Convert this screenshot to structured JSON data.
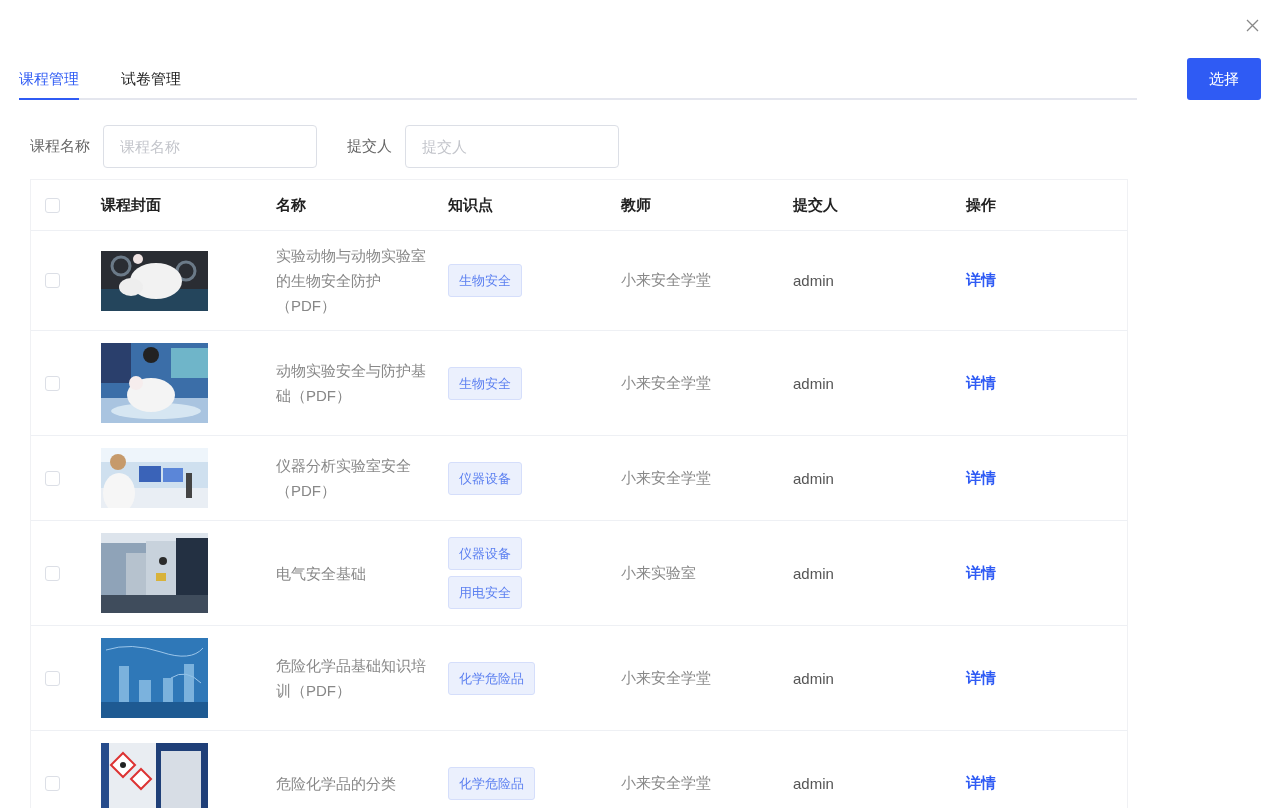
{
  "tabs": [
    {
      "label": "课程管理",
      "selected": true
    },
    {
      "label": "试卷管理",
      "selected": false
    }
  ],
  "select_button": "选择",
  "filters": [
    {
      "label": "课程名称",
      "placeholder": "课程名称"
    },
    {
      "label": "提交人",
      "placeholder": "提交人"
    }
  ],
  "table": {
    "select_all_checked": false,
    "columns": [
      "课程封面",
      "名称",
      "知识点",
      "教师",
      "提交人",
      "操作"
    ],
    "rows": [
      {
        "checked": false,
        "name": "实验动物与动物实验室的生物安全防护（PDF）",
        "tags": [
          "生物安全"
        ],
        "teacher": "小来安全学堂",
        "submitter": "admin",
        "action": "详情"
      },
      {
        "checked": false,
        "name": "动物实验安全与防护基础（PDF）",
        "tags": [
          "生物安全"
        ],
        "teacher": "小来安全学堂",
        "submitter": "admin",
        "action": "详情"
      },
      {
        "checked": false,
        "name": "仪器分析实验室安全（PDF）",
        "tags": [
          "仪器设备"
        ],
        "teacher": "小来安全学堂",
        "submitter": "admin",
        "action": "详情"
      },
      {
        "checked": false,
        "name": "电气安全基础",
        "tags": [
          "仪器设备",
          "用电安全"
        ],
        "teacher": "小来实验室",
        "submitter": "admin",
        "action": "详情"
      },
      {
        "checked": false,
        "name": "危险化学品基础知识培训（PDF）",
        "tags": [
          "化学危险品"
        ],
        "teacher": "小来安全学堂",
        "submitter": "admin",
        "action": "详情"
      },
      {
        "checked": false,
        "name": "危险化学品的分类",
        "tags": [
          "化学危险品"
        ],
        "teacher": "小来安全学堂",
        "submitter": "admin",
        "action": "详情"
      }
    ]
  }
}
